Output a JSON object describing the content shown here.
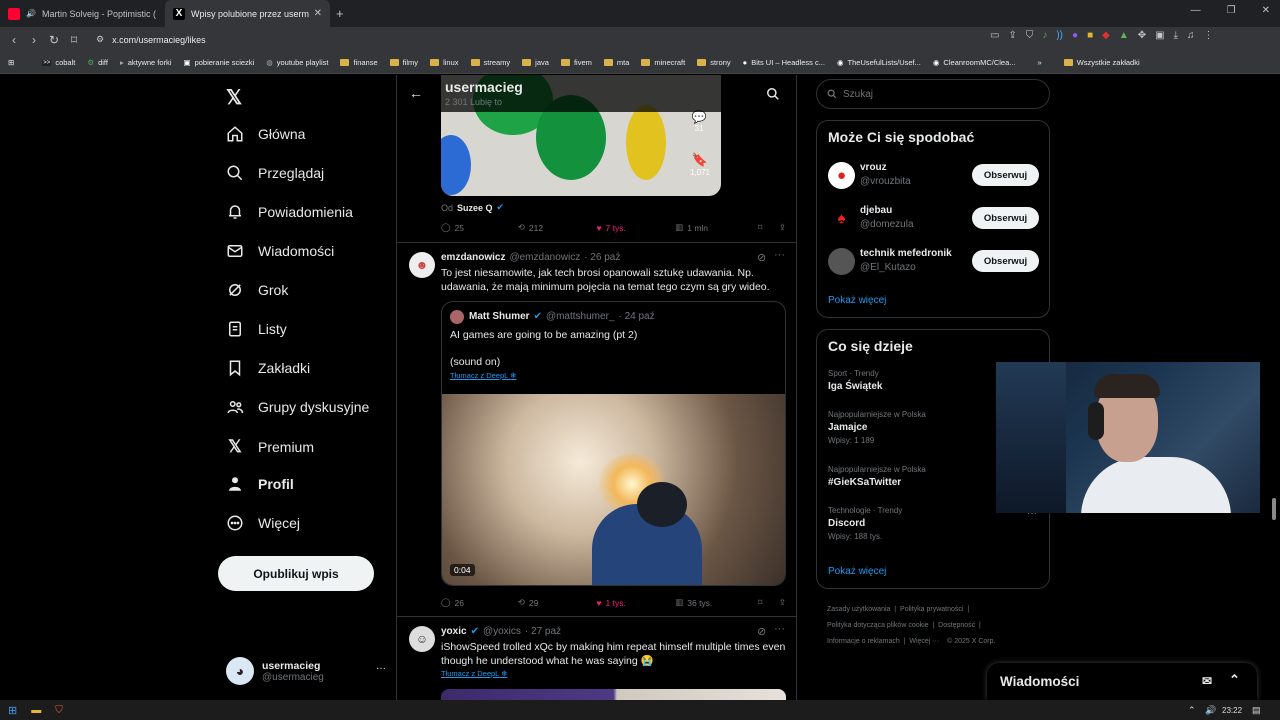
{
  "browser": {
    "tabs": [
      {
        "title": "Martin Solveig - Poptimistic ( Poi",
        "favicon": "youtube-icon"
      },
      {
        "title": "Wpisy polubione przez usermac",
        "favicon": "x-icon"
      }
    ],
    "url": "x.com/usermacieg/likes",
    "bookmarks": [
      "cobalt",
      "diff",
      "aktywne forki",
      "pobieranie sciezki",
      "youtube playlist",
      "finanse",
      "filmy",
      "linux",
      "streamy",
      "java",
      "fivem",
      "mta",
      "minecraft",
      "strony",
      "Bits UI – Headless c...",
      "TheUsefulLists/Usef...",
      "CleanroomMC/Clea..."
    ],
    "bookmarks_more": "»",
    "bookmarks_all": "Wszystkie zakładki"
  },
  "nav": {
    "items": [
      "Główna",
      "Przeglądaj",
      "Powiadomienia",
      "Wiadomości",
      "Grok",
      "Listy",
      "Zakładki",
      "Grupy dyskusyjne",
      "Premium",
      "Profil",
      "Więcej"
    ],
    "post_button": "Opublikuj wpis",
    "account_name": "usermacieg",
    "account_handle": "@usermacieg",
    "account_more": "···"
  },
  "header": {
    "title": "usermacieg",
    "subtitle": "2 301 Lubię to"
  },
  "tweets": {
    "first": {
      "source_prefix": "Od",
      "source_name": "Suzee Q",
      "overlay_comments": "31",
      "overlay_saves": "1,071",
      "replies": "25",
      "reposts": "212",
      "likes": "7 tys.",
      "views": "1 mln"
    },
    "second": {
      "name": "emzdanowicz",
      "handle": "@emzdanowicz",
      "time": "· 26 paź",
      "text": "To jest niesamowite, jak tech brosi opanowali sztukę udawania. Np. udawania, że mają minimum pojęcia na temat tego czym są gry wideo.",
      "quote": {
        "name": "Matt Shumer",
        "handle": "@mattshumer_",
        "time": "· 24 paź",
        "text1": "AI games are going to be amazing (pt 2)",
        "text2": "(sound on)",
        "translate": "Tłumacz z DeepL",
        "video_time": "0:04"
      },
      "replies": "26",
      "reposts": "29",
      "likes": "1 tys.",
      "views": "36 tys."
    },
    "third": {
      "name": "yoxic",
      "handle": "@yoxics",
      "time": "· 27 paź",
      "text": "iShowSpeed trolled xQc by making him repeat himself multiple times even though he understood what he was saying 😭",
      "translate": "Tłumacz z DeepL"
    }
  },
  "search": {
    "placeholder": "Szukaj"
  },
  "suggestions": {
    "title": "Może Ci się spodobać",
    "users": [
      {
        "name": "vrouz",
        "handle": "@vrouzbita"
      },
      {
        "name": "djebau",
        "handle": "@domezula"
      },
      {
        "name": "technik mefedronik",
        "handle": "@El_Kutazo"
      }
    ],
    "follow_label": "Obserwuj",
    "show_more": "Pokaż więcej"
  },
  "trends": {
    "title": "Co się dzieje",
    "items": [
      {
        "context": "Sport · Trendy",
        "name": "Iga Świątek",
        "count": ""
      },
      {
        "context": "Najpopularniejsze w Polska",
        "name": "Jamajce",
        "count": "Wpisy: 1 189"
      },
      {
        "context": "Najpopularniejsze w Polska",
        "name": "#GieKSaTwitter",
        "count": ""
      },
      {
        "context": "Technologie · Trendy",
        "name": "Discord",
        "count": "Wpisy: 188 tys."
      }
    ],
    "show_more": "Pokaż więcej"
  },
  "footer": {
    "links": [
      "Zasady użytkowania",
      "Polityka prywatności",
      "Polityka dotycząca plików cookie",
      "Dostępność",
      "Informacje o reklamach",
      "Więcej ···",
      "© 2025 X Corp."
    ]
  },
  "dm": {
    "title": "Wiadomości"
  },
  "taskbar": {
    "time": "23:22"
  },
  "colors": {
    "accent": "#1d9bf0",
    "like": "#f91880",
    "muted": "#71767b",
    "verified": "#1d9bf0"
  }
}
